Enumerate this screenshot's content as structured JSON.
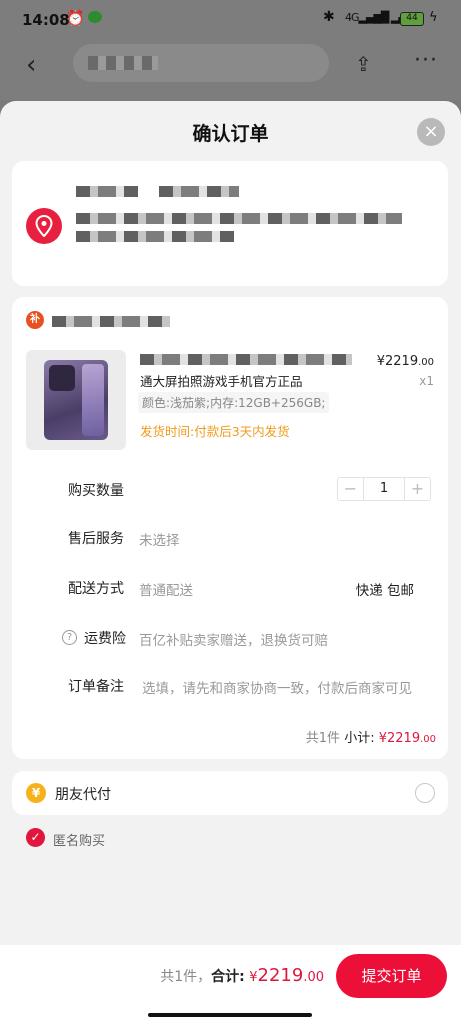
{
  "status": {
    "time": "14:08",
    "battery": "44"
  },
  "sheet": {
    "title": "确认订单",
    "close_icon": "×"
  },
  "product": {
    "name_line2": "通大屏拍照游戏手机官方正品",
    "spec": "颜色:浅茄紫;内存:12GB+256GB;",
    "shipping": "发货时间:付款后3天内发货",
    "price_symbol": "¥",
    "price_int": "2219",
    "price_dec": ".00",
    "quantity_x": "x1"
  },
  "rows": {
    "qty_label": "购买数量",
    "qty_value": "1",
    "qty_minus": "−",
    "qty_plus": "+",
    "after_label": "售后服务",
    "after_value": "未选择",
    "delivery_label": "配送方式",
    "delivery_value": "普通配送",
    "delivery_right": "快递 包邮",
    "insurance_label": "运费险",
    "insurance_value": "百亿补贴卖家赠送，退换货可赔",
    "note_label": "订单备注",
    "note_placeholder": "选填，请先和商家协商一致，付款后商家可见"
  },
  "subtotal": {
    "count": "共1件",
    "label": "小计:",
    "symbol": "¥",
    "int": "2219",
    "dec": ".00"
  },
  "friend_pay": {
    "label": "朋友代付",
    "icon": "¥"
  },
  "anonymous": {
    "label": "匿名购买"
  },
  "bottom": {
    "count": "共1件，",
    "label": "合计:",
    "symbol": "¥",
    "int": "2219",
    "dec": ".00",
    "submit": "提交订单"
  },
  "shop_badge": "补"
}
